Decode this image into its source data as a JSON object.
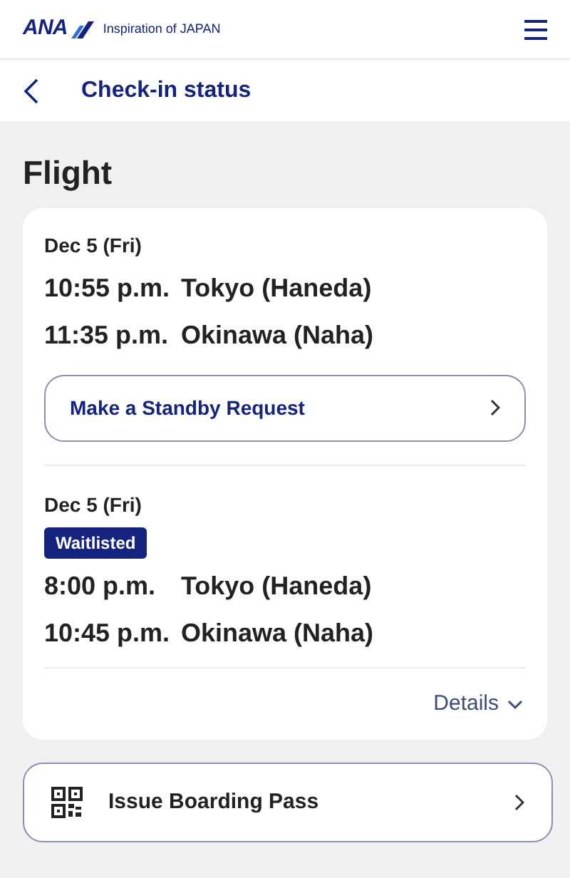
{
  "header": {
    "logo": "ANA",
    "tagline": "Inspiration of JAPAN"
  },
  "nav": {
    "title": "Check-in status"
  },
  "section_title": "Flight",
  "segments": [
    {
      "date": "Dec 5 (Fri)",
      "departure_time": "10:55 p.m.",
      "departure_airport": "Tokyo (Haneda)",
      "arrival_time": "11:35 p.m.",
      "arrival_airport": "Okinawa (Naha)",
      "action": "Make a Standby Request"
    },
    {
      "date": "Dec 5 (Fri)",
      "badge": "Waitlisted",
      "departure_time": "8:00 p.m.",
      "departure_airport": "Tokyo (Haneda)",
      "arrival_time": "10:45 p.m.",
      "arrival_airport": "Okinawa (Naha)"
    }
  ],
  "details_link": "Details",
  "boarding_pass_button": "Issue Boarding Pass"
}
